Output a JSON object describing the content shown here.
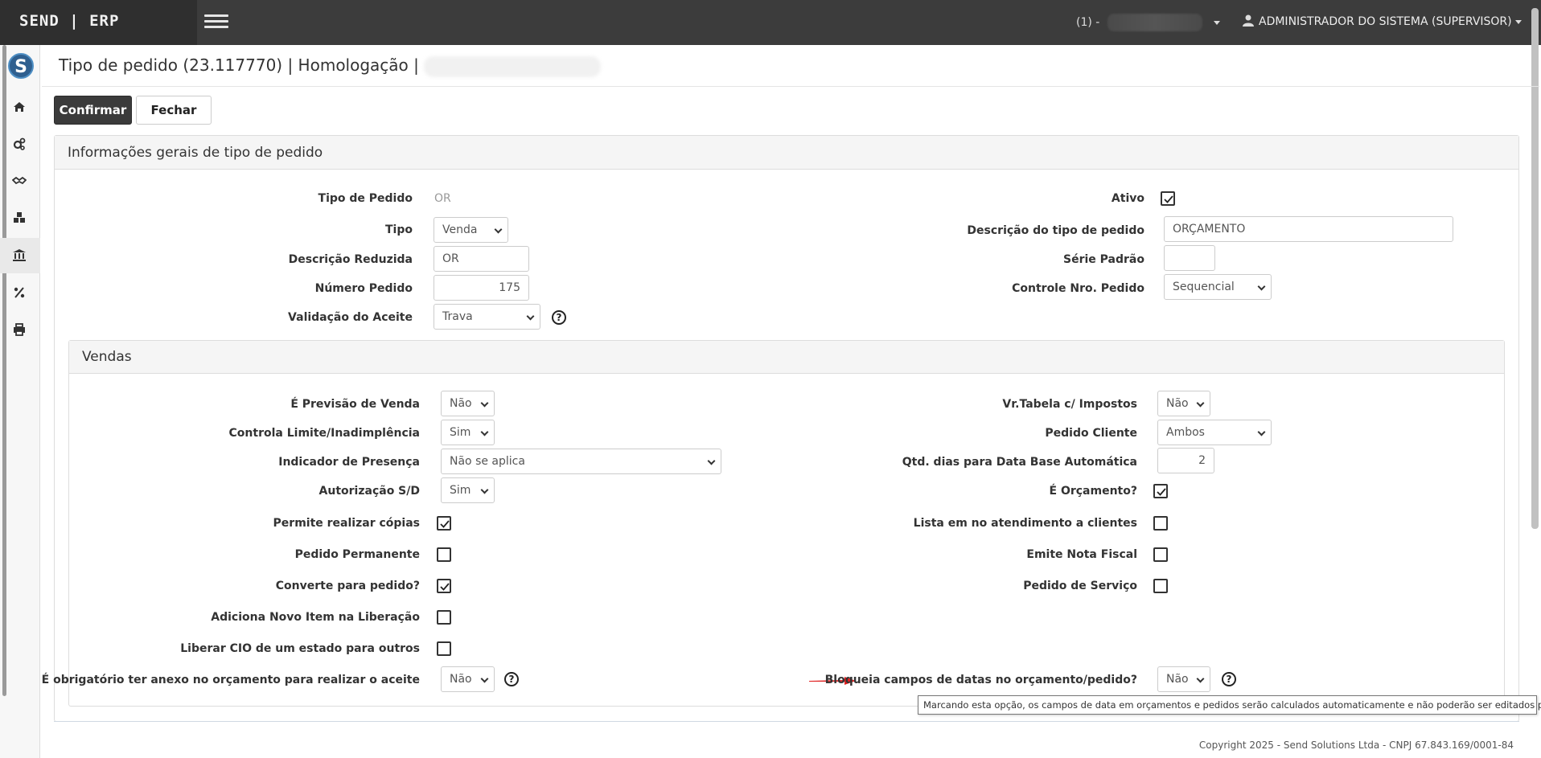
{
  "app": {
    "brand": "SEND | ERP"
  },
  "topbar": {
    "company_prefix": "(1) -",
    "user_name": "ADMINISTRADOR DO SISTEMA (SUPERVISOR)"
  },
  "sidebar": {
    "logo_letter": "S",
    "icons": [
      "home-icon",
      "cogs-icon",
      "handshake-icon",
      "cubes-icon",
      "bank-icon",
      "percent-icon",
      "print-icon"
    ]
  },
  "page": {
    "title": "Tipo de pedido (23.117770) | Homologação |"
  },
  "toolbar": {
    "confirm_label": "Confirmar",
    "close_label": "Fechar"
  },
  "general": {
    "header": "Informações gerais de tipo de pedido",
    "tipo_pedido_label": "Tipo de Pedido",
    "tipo_pedido_value": "OR",
    "tipo_label": "Tipo",
    "tipo_value": "Venda",
    "desc_reduzida_label": "Descrição Reduzida",
    "desc_reduzida_value": "OR",
    "numero_pedido_label": "Número Pedido",
    "numero_pedido_value": "175",
    "validacao_aceite_label": "Validação do Aceite",
    "validacao_aceite_value": "Trava",
    "ativo_label": "Ativo",
    "ativo_checked": true,
    "desc_tipo_label": "Descrição do tipo de pedido",
    "desc_tipo_value": "ORÇAMENTO",
    "serie_padrao_label": "Série Padrão",
    "serie_padrao_value": "",
    "controle_nro_label": "Controle Nro. Pedido",
    "controle_nro_value": "Sequencial"
  },
  "vendas": {
    "header": "Vendas",
    "previsao_label": "É Previsão de Venda",
    "previsao_value": "Não",
    "controla_limite_label": "Controla Limite/Inadimplência",
    "controla_limite_value": "Sim",
    "indicador_presenca_label": "Indicador de Presença",
    "indicador_presenca_value": "Não se aplica",
    "autorizacao_label": "Autorização S/D",
    "autorizacao_value": "Sim",
    "permite_copias_label": "Permite realizar cópias",
    "permite_copias_checked": true,
    "pedido_permanente_label": "Pedido Permanente",
    "pedido_permanente_checked": false,
    "converte_label": "Converte para pedido?",
    "converte_checked": true,
    "adiciona_novo_label": "Adiciona Novo Item na Liberação",
    "adiciona_novo_checked": false,
    "liberar_cio_label": "Liberar CIO de um estado para outros",
    "liberar_cio_checked": false,
    "obrigatorio_anexo_label": "É obrigatório ter anexo no orçamento para realizar o aceite",
    "obrigatorio_anexo_value": "Não",
    "vr_tabela_label": "Vr.Tabela c/ Impostos",
    "vr_tabela_value": "Não",
    "pedido_cliente_label": "Pedido Cliente",
    "pedido_cliente_value": "Ambos",
    "qtd_dias_label": "Qtd. dias para Data Base Automática",
    "qtd_dias_value": "2",
    "e_orcamento_label": "É Orçamento?",
    "e_orcamento_checked": true,
    "lista_atendimento_label": "Lista em no atendimento a clientes",
    "lista_atendimento_checked": false,
    "emite_nf_label": "Emite Nota Fiscal",
    "emite_nf_checked": false,
    "pedido_servico_label": "Pedido de Serviço",
    "pedido_servico_checked": false,
    "bloqueia_datas_label": "Bloqueia campos de datas no orçamento/pedido?",
    "bloqueia_datas_value": "Não"
  },
  "tooltip": {
    "text": "Marcando esta opção, os campos de data em orçamentos e pedidos serão calculados automaticamente e não poderão ser editados pelo usuário."
  },
  "footer": {
    "text": "Copyright 2025 - Send Solutions Ltda - CNPJ 67.843.169/0001-84"
  },
  "colors": {
    "topbar": "#3c3c3c",
    "primary_button": "#3b3b3b",
    "annotation_arrow": "#e02020"
  }
}
